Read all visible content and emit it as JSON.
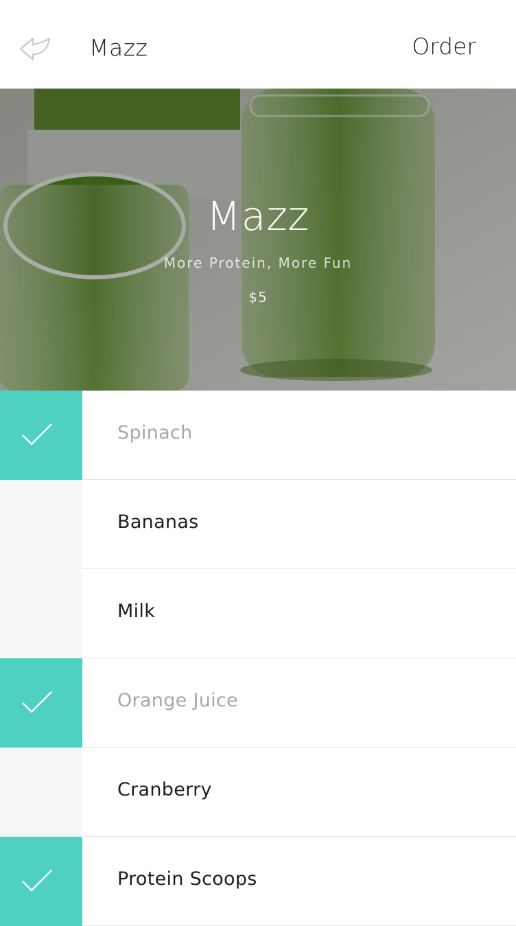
{
  "header": {
    "title": "Mazz",
    "order_label": "Order",
    "back_icon": "back-arrow-icon"
  },
  "hero": {
    "title": "Mazz",
    "subtitle": "More Protein, More Fun",
    "price": "$5",
    "image_subject": "green smoothie in glass and mason jar"
  },
  "colors": {
    "accent": "#4fd1c2",
    "unchecked_cell": "#f6f6f6",
    "selected_text": "#a8a8a8",
    "text": "#1e1e1e"
  },
  "ingredients": [
    {
      "label": "Spinach",
      "checked": true
    },
    {
      "label": "Bananas",
      "checked": false
    },
    {
      "label": "Milk",
      "checked": false
    },
    {
      "label": "Orange Juice",
      "checked": true
    },
    {
      "label": "Cranberry",
      "checked": false
    },
    {
      "label": "Protein Scoops",
      "checked": true
    }
  ]
}
